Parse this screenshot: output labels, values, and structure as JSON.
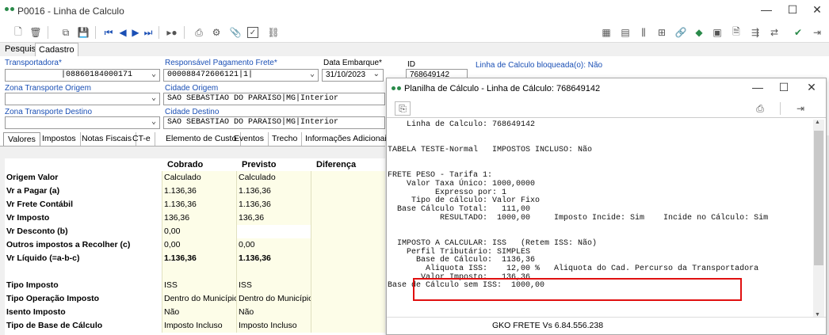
{
  "window": {
    "title": "P0016 - Linha de Calculo",
    "controls": [
      "—",
      "☐",
      "✕"
    ]
  },
  "tabs_top": [
    "Pesquisa",
    "Cadastro"
  ],
  "form": {
    "transportadora_label": "Transportadora*",
    "transportadora_value": "|08860184000171",
    "resp_pag_label": "Responsável Pagamento Frete*",
    "resp_pag_value": "000088472606121|1|",
    "data_embarque_label": "Data Embarque*",
    "data_embarque_value": "31/10/2023",
    "id_label": "ID",
    "id_value": "768649142",
    "bloqueada_label": "Linha de Calculo bloqueada(o): Não",
    "zona_origem_label": "Zona Transporte Origem",
    "zona_origem_value": "",
    "cidade_origem_label": "Cidade Origem",
    "cidade_origem_value": "SAO SEBASTIAO DO PARAISO|MG|Interior",
    "zona_destino_label": "Zona Transporte Destino",
    "zona_destino_value": "",
    "cidade_destino_label": "Cidade Destino",
    "cidade_destino_value": "SAO SEBASTIAO DO PARAISO|MG|Interior"
  },
  "subtabs": [
    "Valores",
    "Impostos",
    "Notas Fiscais",
    "CT-e",
    "Elemento de Custo",
    "Eventos",
    "Trecho",
    "Informações Adicionais"
  ],
  "grid": {
    "headers": [
      "Cobrado",
      "Previsto",
      "Diferença"
    ],
    "rows": [
      {
        "label": "Origem Valor",
        "cobrado": "Calculado",
        "previsto": "Calculado",
        "diferenca": ""
      },
      {
        "label": "Vr a Pagar (a)",
        "cobrado": "1.136,36",
        "previsto": "1.136,36",
        "diferenca": ""
      },
      {
        "label": "Vr Frete Contábil",
        "cobrado": "1.136,36",
        "previsto": "1.136,36",
        "diferenca": ""
      },
      {
        "label": "Vr Imposto",
        "cobrado": "136,36",
        "previsto": "136,36",
        "diferenca": ""
      },
      {
        "label": "Vr Desconto (b)",
        "cobrado": "0,00",
        "previsto": "",
        "diferenca": ""
      },
      {
        "label": "Outros impostos a Recolher (c)",
        "cobrado": "0,00",
        "previsto": "0,00",
        "diferenca": ""
      },
      {
        "label": "Vr Líquido (=a-b-c)",
        "cobrado": "1.136,36",
        "previsto": "1.136,36",
        "diferenca": ""
      },
      {
        "label": "",
        "cobrado": "",
        "previsto": "",
        "diferenca": ""
      },
      {
        "label": "Tipo Imposto",
        "cobrado": "ISS",
        "previsto": "ISS",
        "diferenca": ""
      },
      {
        "label": "Tipo Operação Imposto",
        "cobrado": "Dentro do Município",
        "previsto": "Dentro do Município",
        "diferenca": ""
      },
      {
        "label": "Isento Imposto",
        "cobrado": "Não",
        "previsto": "Não",
        "diferenca": ""
      },
      {
        "label": "Tipo de Base de Cálculo",
        "cobrado": "Imposto Incluso",
        "previsto": "Imposto Incluso",
        "diferenca": ""
      }
    ]
  },
  "dialog": {
    "title": "Planilha de Cálculo - Linha de Cálculo: 768649142",
    "status": "GKO FRETE Vs 6.84.556.238",
    "report_lines": [
      "    Linha de Calculo: 768649142",
      "",
      "",
      "TABELA TESTE-Normal   IMPOSTOS INCLUSO: Não",
      "",
      "",
      "FRETE PESO - Tarifa 1:",
      "    Valor Taxa Único: 1000,0000",
      "          Expresso por: 1",
      "     Tipo de cálculo: Valor Fixo",
      "  Base Cálculo Total:   111,00",
      "           RESULTADO:  1000,00     Imposto Incide: Sim    Incide no Cálculo: Sim",
      "",
      "",
      "  IMPOSTO A CALCULAR: ISS   (Retem ISS: Não)",
      "    Perfil Tributário: SIMPLES",
      "      Base de Cálculo:  1136,36",
      "        Aliquota ISS:    12,00 %   Aliquota do Cad. Percurso da Transportadora",
      "       Valor Imposto:   136,36",
      "Base de Cálculo sem ISS:  1000,00"
    ]
  },
  "colors": {
    "accent_green": "#2a8a4a",
    "grid_yellow": "#fdfde8",
    "highlight_red": "#e01010",
    "label_blue": "#1a4fb5"
  }
}
